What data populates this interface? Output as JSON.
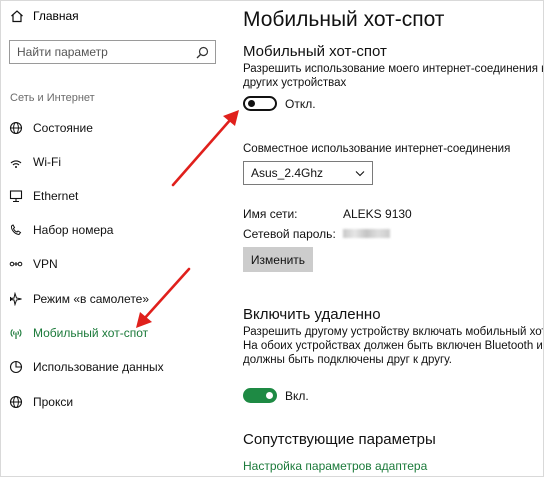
{
  "sidebar": {
    "home_label": "Главная",
    "search_placeholder": "Найти параметр",
    "section_label": "Сеть и Интернет",
    "items": [
      {
        "label": "Состояние",
        "icon": "globe-icon"
      },
      {
        "label": "Wi-Fi",
        "icon": "wifi-icon"
      },
      {
        "label": "Ethernet",
        "icon": "monitor-icon"
      },
      {
        "label": "Набор номера",
        "icon": "dialup-icon"
      },
      {
        "label": "VPN",
        "icon": "vpn-icon"
      },
      {
        "label": "Режим «в самолете»",
        "icon": "airplane-icon"
      },
      {
        "label": "Мобильный хот-спот",
        "icon": "hotspot-icon",
        "active": true
      },
      {
        "label": "Использование данных",
        "icon": "pie-chart-icon"
      },
      {
        "label": "Прокси",
        "icon": "globe-icon"
      }
    ]
  },
  "main": {
    "title": "Мобильный хот-спот",
    "hotspot": {
      "heading": "Мобильный хот-спот",
      "description_line1": "Разрешить использование моего интернет-соединения на",
      "description_line2": "других устройствах",
      "toggle_state": "off",
      "toggle_label": "Откл.",
      "share_label": "Совместное использование интернет-соединения",
      "share_selected": "Asus_2.4Ghz",
      "network_name_label": "Имя сети:",
      "network_name_value": "ALEKS 9130",
      "password_label": "Сетевой пароль:",
      "edit_button": "Изменить"
    },
    "remote": {
      "heading": "Включить удаленно",
      "line1": "Разрешить другому устройству включать мобильный хот-спот.",
      "line2": "На обоих устройствах должен быть включен Bluetooth и они",
      "line3": "должны быть подключены друг к другу.",
      "toggle_state": "on",
      "toggle_label": "Вкл."
    },
    "related": {
      "heading": "Сопутствующие параметры",
      "link": "Настройка параметров адаптера"
    }
  },
  "colors": {
    "accent_green": "#1b7a3a",
    "toggle_on": "#1e8a44",
    "annotation_red": "#e0201c"
  }
}
